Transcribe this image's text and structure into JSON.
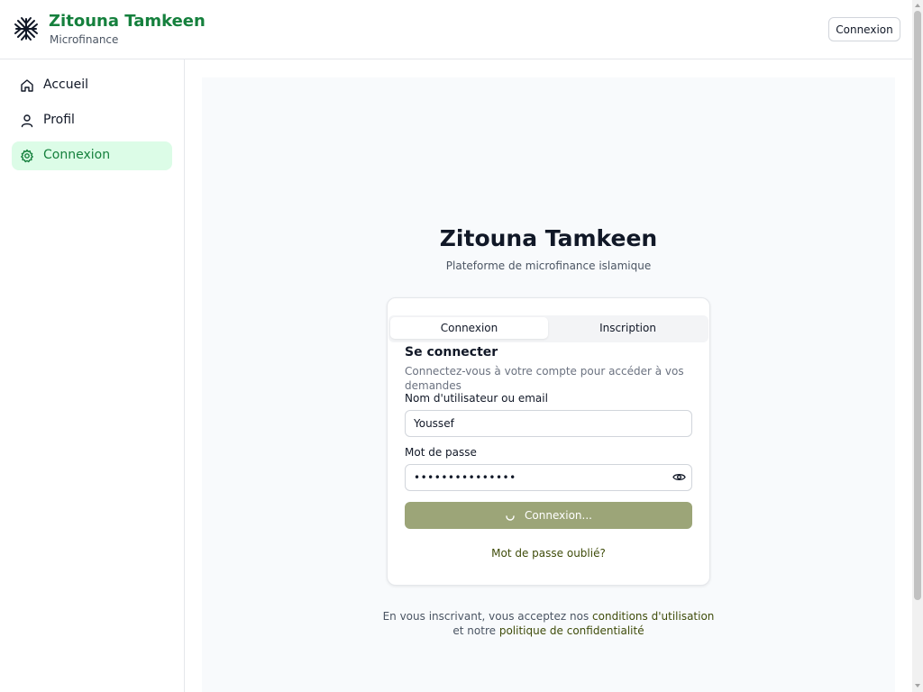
{
  "header": {
    "brand_title": "Zitouna Tamkeen",
    "brand_subtitle": "Microfinance",
    "login_button": "Connexion",
    "logo_icon": "tree-logo-icon"
  },
  "sidebar": {
    "items": [
      {
        "label": "Accueil",
        "icon": "home-icon",
        "active": false
      },
      {
        "label": "Profil",
        "icon": "user-icon",
        "active": false
      },
      {
        "label": "Connexion",
        "icon": "gear-icon",
        "active": true
      }
    ]
  },
  "main": {
    "title": "Zitouna Tamkeen",
    "subtitle": "Plateforme de microfinance islamique",
    "tabs": [
      {
        "label": "Connexion",
        "active": true
      },
      {
        "label": "Inscription",
        "active": false
      }
    ],
    "form": {
      "title": "Se connecter",
      "description": "Connectez-vous à votre compte pour accéder à vos demandes",
      "username_label": "Nom d'utilisateur ou email",
      "username_value": "Youssef",
      "password_label": "Mot de passe",
      "password_value": "•••••••••••••••",
      "submit_label": "Connexion...",
      "forgot_link": "Mot de passe oublié?"
    },
    "terms": {
      "prefix": "En vous inscrivant, vous acceptez nos",
      "conditions_link": "conditions d'utilisation",
      "middle": "et notre",
      "privacy_link": "politique de confidentialité"
    }
  },
  "colors": {
    "brand": "#15803d",
    "active_nav_bg": "#dcfce7",
    "button_disabled": "#9ca578",
    "link": "#3f4c0a"
  }
}
